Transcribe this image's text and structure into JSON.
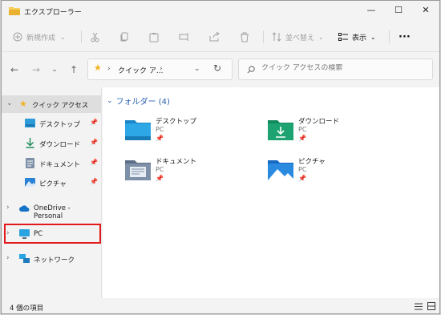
{
  "window": {
    "title": "エクスプローラー"
  },
  "window_controls": {
    "minimize": "—",
    "maximize": "☐",
    "close": "✕"
  },
  "toolbar": {
    "new_label": "新規作成",
    "sort_label": "並べ替え",
    "view_label": "表示",
    "more_label": "···"
  },
  "address": {
    "crumb_star": "★",
    "crumb_sep1": "›",
    "crumb_text": "クイック ア...",
    "crumb_sep2": "›"
  },
  "search": {
    "placeholder": "クイック アクセスの検索"
  },
  "nav": {
    "quick_access": "クイック アクセス",
    "desktop": "デスクトップ",
    "downloads": "ダウンロード",
    "documents": "ドキュメント",
    "pictures": "ピクチャ",
    "onedrive": "OneDrive - Personal",
    "pc": "PC",
    "network": "ネットワーク"
  },
  "content": {
    "group_header": "フォルダー (4)",
    "folders": [
      {
        "name": "デスクトップ",
        "location": "PC"
      },
      {
        "name": "ダウンロード",
        "location": "PC"
      },
      {
        "name": "ドキュメント",
        "location": "PC"
      },
      {
        "name": "ピクチャ",
        "location": "PC"
      }
    ]
  },
  "status": {
    "count": "4 個の項目"
  }
}
